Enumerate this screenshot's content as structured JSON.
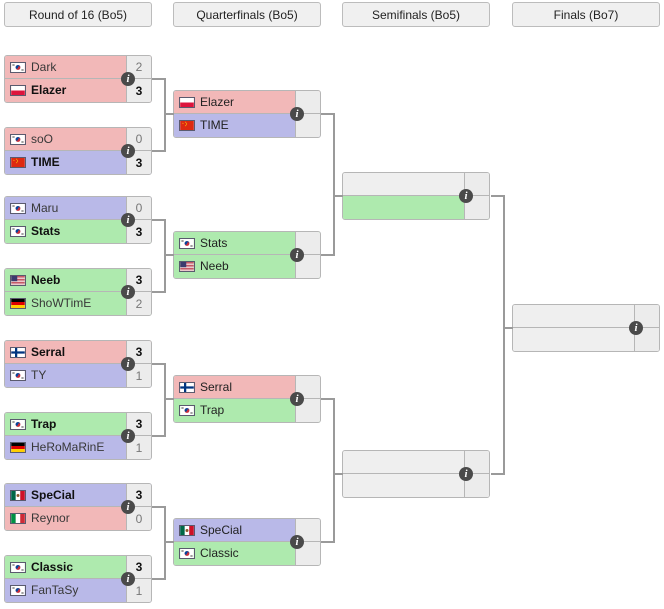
{
  "headers": [
    {
      "label": "Round of 16 (Bo5)"
    },
    {
      "label": "Quarterfinals (Bo5)"
    },
    {
      "label": "Semifinals (Bo5)"
    },
    {
      "label": "Finals (Bo7)"
    }
  ],
  "info_label": "i",
  "colors": {
    "zerg": "#f2b8b8",
    "terran": "#b9b9e8",
    "protoss": "#aeeaae",
    "empty": "#efefef",
    "connector": "#9a9a9a",
    "border": "#b6b6b6",
    "header_bg": "#f0f0f0"
  },
  "rounds": {
    "ro16": {
      "matches": [
        {
          "top": {
            "name": "Dark",
            "flag": "kr",
            "score": "2",
            "result": "lose",
            "race": "zerg"
          },
          "bottom": {
            "name": "Elazer",
            "flag": "pl",
            "score": "3",
            "result": "win",
            "race": "zerg"
          }
        },
        {
          "top": {
            "name": "soO",
            "flag": "kr",
            "score": "0",
            "result": "lose",
            "race": "zerg"
          },
          "bottom": {
            "name": "TIME",
            "flag": "cn",
            "score": "3",
            "result": "win",
            "race": "terran"
          }
        },
        {
          "top": {
            "name": "Maru",
            "flag": "kr",
            "score": "0",
            "result": "lose",
            "race": "terran"
          },
          "bottom": {
            "name": "Stats",
            "flag": "kr",
            "score": "3",
            "result": "win",
            "race": "protoss"
          }
        },
        {
          "top": {
            "name": "Neeb",
            "flag": "us",
            "score": "3",
            "result": "win",
            "race": "protoss"
          },
          "bottom": {
            "name": "ShoWTimE",
            "flag": "de",
            "score": "2",
            "result": "lose",
            "race": "protoss"
          }
        },
        {
          "top": {
            "name": "Serral",
            "flag": "fi",
            "score": "3",
            "result": "win",
            "race": "zerg"
          },
          "bottom": {
            "name": "TY",
            "flag": "kr",
            "score": "1",
            "result": "lose",
            "race": "terran"
          }
        },
        {
          "top": {
            "name": "Trap",
            "flag": "kr",
            "score": "3",
            "result": "win",
            "race": "protoss"
          },
          "bottom": {
            "name": "HeRoMaRinE",
            "flag": "de",
            "score": "1",
            "result": "lose",
            "race": "terran"
          }
        },
        {
          "top": {
            "name": "SpeCial",
            "flag": "mx",
            "score": "3",
            "result": "win",
            "race": "terran"
          },
          "bottom": {
            "name": "Reynor",
            "flag": "it",
            "score": "0",
            "result": "lose",
            "race": "zerg"
          }
        },
        {
          "top": {
            "name": "Classic",
            "flag": "kr",
            "score": "3",
            "result": "win",
            "race": "protoss"
          },
          "bottom": {
            "name": "FanTaSy",
            "flag": "kr",
            "score": "1",
            "result": "lose",
            "race": "terran"
          }
        }
      ]
    },
    "quarterfinals": {
      "matches": [
        {
          "top": {
            "name": "Elazer",
            "flag": "pl",
            "score": "",
            "result": "none",
            "race": "zerg"
          },
          "bottom": {
            "name": "TIME",
            "flag": "cn",
            "score": "",
            "result": "none",
            "race": "terran"
          }
        },
        {
          "top": {
            "name": "Stats",
            "flag": "kr",
            "score": "",
            "result": "none",
            "race": "protoss"
          },
          "bottom": {
            "name": "Neeb",
            "flag": "us",
            "score": "",
            "result": "none",
            "race": "protoss"
          }
        },
        {
          "top": {
            "name": "Serral",
            "flag": "fi",
            "score": "",
            "result": "none",
            "race": "zerg"
          },
          "bottom": {
            "name": "Trap",
            "flag": "kr",
            "score": "",
            "result": "none",
            "race": "protoss"
          }
        },
        {
          "top": {
            "name": "SpeCial",
            "flag": "mx",
            "score": "",
            "result": "none",
            "race": "terran"
          },
          "bottom": {
            "name": "Classic",
            "flag": "kr",
            "score": "",
            "result": "none",
            "race": "protoss"
          }
        }
      ]
    },
    "semifinals": {
      "matches": [
        {
          "top": {
            "name": "",
            "flag": "none",
            "score": "",
            "result": "none",
            "race": "empty"
          },
          "bottom": {
            "name": "",
            "flag": "none",
            "score": "",
            "result": "none",
            "race": "protoss"
          }
        },
        {
          "top": {
            "name": "",
            "flag": "none",
            "score": "",
            "result": "none",
            "race": "empty"
          },
          "bottom": {
            "name": "",
            "flag": "none",
            "score": "",
            "result": "none",
            "race": "empty"
          }
        }
      ]
    },
    "finals": {
      "matches": [
        {
          "top": {
            "name": "",
            "flag": "none",
            "score": "",
            "result": "none",
            "race": "empty"
          },
          "bottom": {
            "name": "",
            "flag": "none",
            "score": "",
            "result": "none",
            "race": "empty"
          }
        }
      ]
    }
  }
}
